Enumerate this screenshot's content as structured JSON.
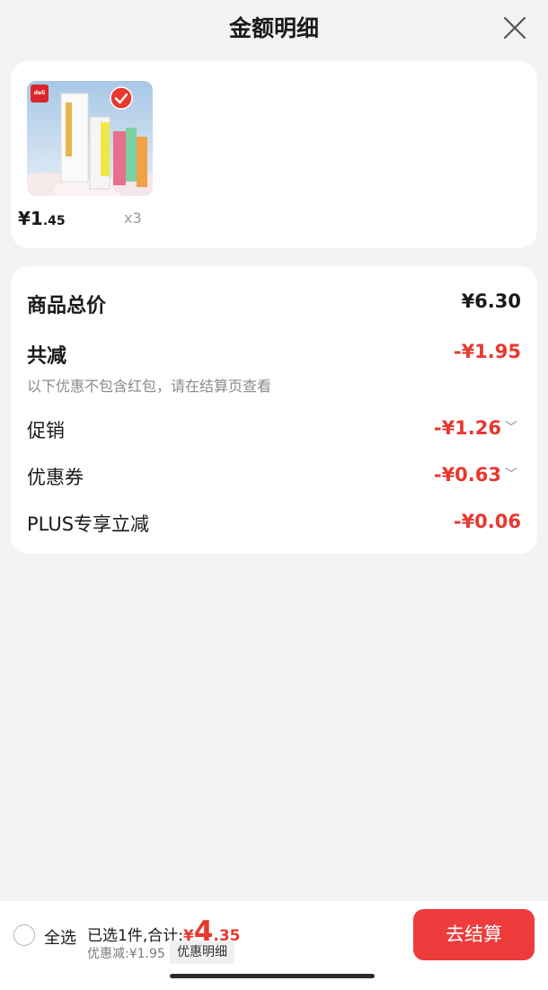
{
  "header": {
    "title": "金额明细",
    "close_icon": "close-icon"
  },
  "product": {
    "brand": "deli",
    "price_main": "¥1",
    "price_decimal": ".45",
    "quantity": "x3",
    "selected": true
  },
  "summary": {
    "total_label": "商品总价",
    "total_value": "¥6.30",
    "reduce_label": "共减",
    "reduce_value": "-¥1.95",
    "note": "以下优惠不包含红包，请在结算页查看",
    "items": [
      {
        "label": "促销",
        "value": "-¥1.26",
        "expandable": true
      },
      {
        "label": "优惠券",
        "value": "-¥0.63",
        "expandable": true
      },
      {
        "label": "PLUS专享立减",
        "value": "-¥0.06",
        "expandable": false
      }
    ]
  },
  "bottom_bar": {
    "select_all": "全选",
    "selected_text": "已选1件,合计:",
    "total_symbol": "¥",
    "total_int": "4",
    "total_dec": ".35",
    "discount_text": "优惠减:¥1.95",
    "detail_button": "优惠明细",
    "checkout_button": "去结算"
  },
  "colors": {
    "accent": "#e8382f",
    "checkout": "#ee3b3b",
    "background": "#f3f3f3"
  }
}
